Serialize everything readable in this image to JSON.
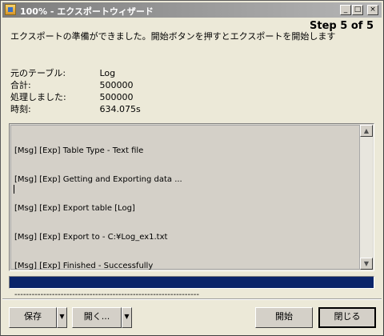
{
  "window": {
    "title": "100% - エクスポートウィザード",
    "controls": {
      "minimize": "_",
      "maximize": "□",
      "close": "×"
    }
  },
  "header": {
    "instruction": "エクスポートの準備ができました。開始ボタンを押すとエクスポートを開始します",
    "step": "Step 5 of 5"
  },
  "info": [
    {
      "label": "元のテーブル:",
      "value": "Log"
    },
    {
      "label": "合計:",
      "value": "500000"
    },
    {
      "label": "処理しました:",
      "value": "500000"
    },
    {
      "label": "時刻:",
      "value": "634.075s"
    }
  ],
  "log": {
    "lines": [
      "[Msg] [Exp] Table Type - Text file",
      "[Msg] [Exp] Getting and Exporting data ...",
      "[Msg] [Exp] Export table [Log]",
      "[Msg] [Exp] Export to - C:¥Log_ex1.txt",
      "[Msg] [Exp] Finished - Successfully",
      "----------------------------------------------------------------"
    ],
    "scroll_up": "▲",
    "scroll_down": "▼"
  },
  "progress": {
    "value": 1.0
  },
  "buttons": {
    "save": "保存",
    "save_arrow": "▼",
    "open": "開く...",
    "open_arrow": "▼",
    "start": "開始",
    "close": "閉じる"
  }
}
